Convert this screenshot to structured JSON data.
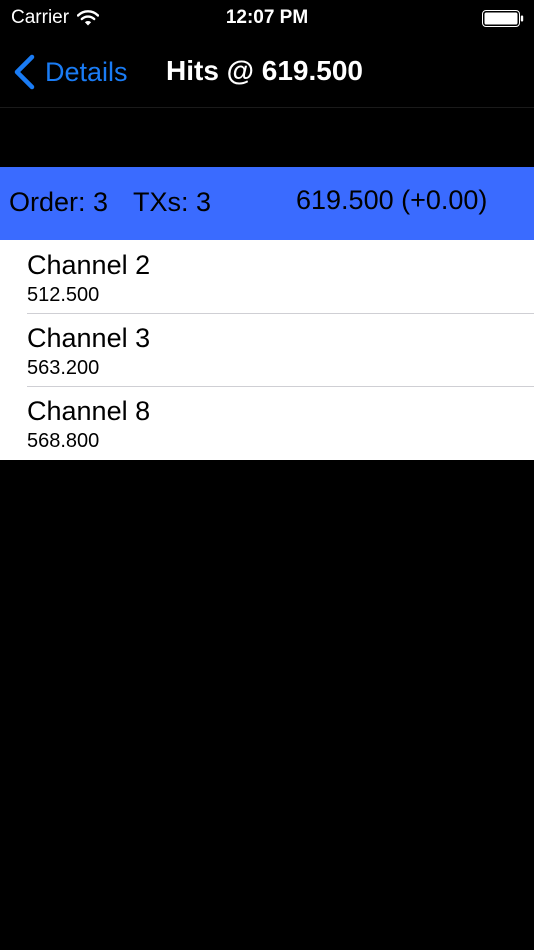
{
  "status_bar": {
    "carrier": "Carrier",
    "time": "12:07 PM",
    "icons": [
      "wifi-icon",
      "battery-icon"
    ]
  },
  "nav": {
    "back_label": "Details",
    "title": "Hits @ 619.500",
    "accent_color": "#1a7cf5"
  },
  "summary": {
    "order": "Order: 3",
    "txs": "TXs: 3",
    "frequency": "619.500 (+0.00)",
    "background_color": "#3a6bff"
  },
  "channels": [
    {
      "name": "Channel 2",
      "frequency": "512.500"
    },
    {
      "name": "Channel 3",
      "frequency": "563.200"
    },
    {
      "name": "Channel 8",
      "frequency": "568.800"
    }
  ]
}
